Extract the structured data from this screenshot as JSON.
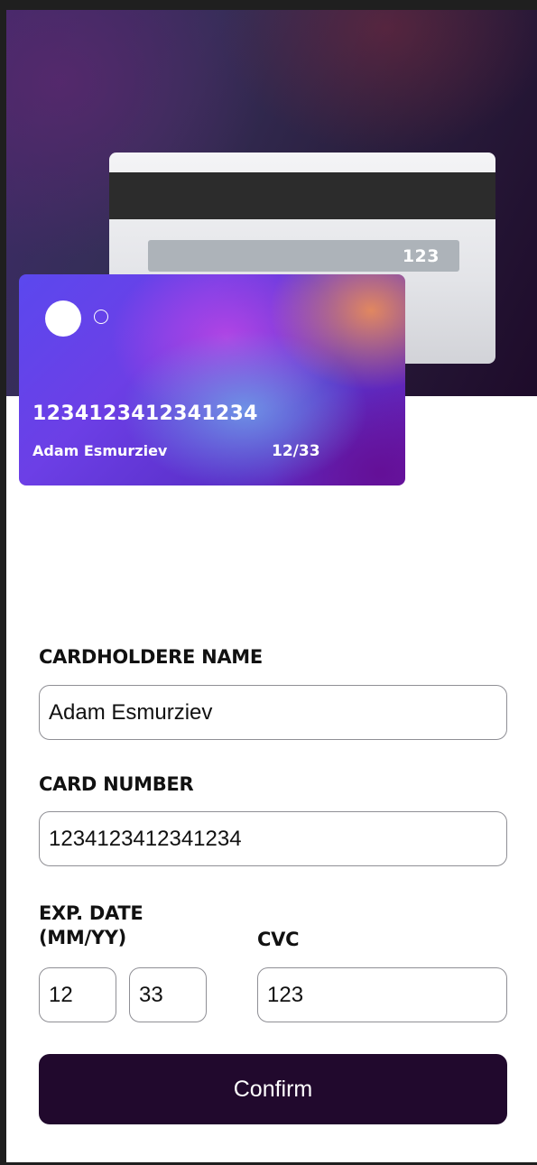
{
  "card_preview": {
    "number": "1234123412341234",
    "name": "Adam Esmurziev",
    "expiry": "12/33",
    "cvc": "123"
  },
  "form": {
    "name_label": "CARDHOLDERE NAME",
    "name_value": "Adam Esmurziev",
    "number_label": "CARD NUMBER",
    "number_value": "1234123412341234",
    "exp_label_line1": "EXP. DATE",
    "exp_label_line2": "(MM/YY)",
    "exp_month_value": "12",
    "exp_year_value": "33",
    "cvc_label": "CVC",
    "cvc_value": "123"
  },
  "confirm_label": "Confirm",
  "colors": {
    "button_bg": "#21092d",
    "hero_dark": "#1e0b2a"
  }
}
